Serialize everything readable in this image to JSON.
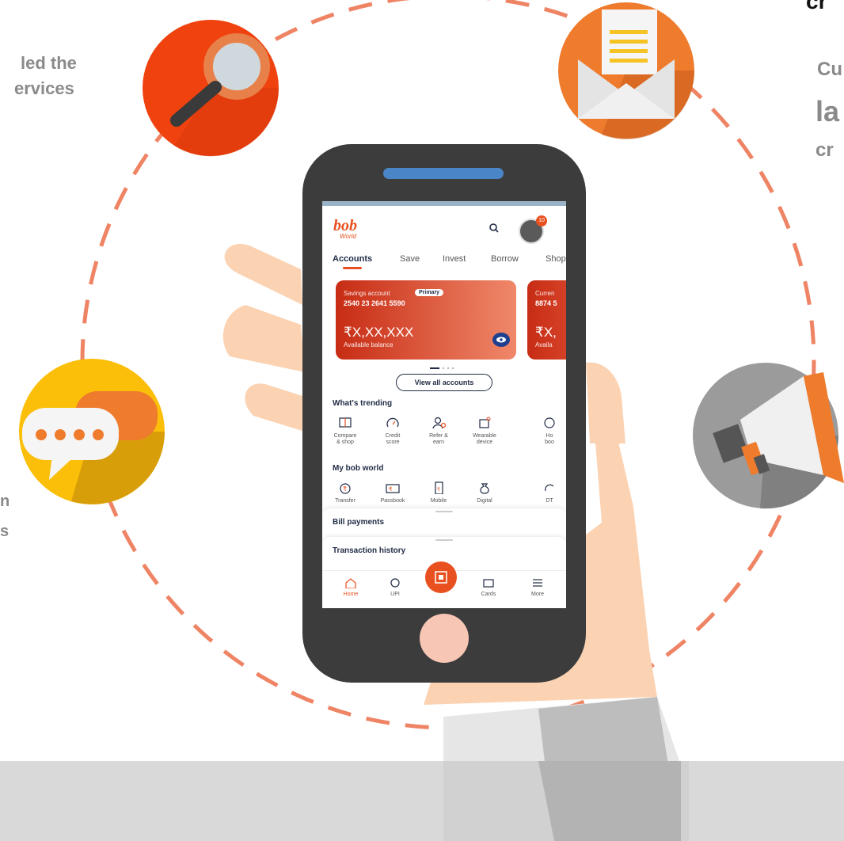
{
  "fragments": {
    "left_top_1": "led the",
    "left_top_2": "ervices",
    "left_mid_1": "n",
    "left_mid_2": "s",
    "right_top_1": "cr",
    "right_top_2": "Cu",
    "right_top_3": "la",
    "right_top_4": "cr"
  },
  "icons": [
    "search-icon",
    "envelope-icon",
    "chat-icon",
    "megaphone-icon"
  ],
  "colors": {
    "accent": "#e8501f",
    "dashed_circle": "#ef8465",
    "phone_body": "#3c3c3c",
    "hand": "#fbd3b3"
  },
  "app": {
    "logo": "bob",
    "logo_sub": "World",
    "notification_count": "10",
    "tabs": [
      "Accounts",
      "Save",
      "Invest",
      "Borrow",
      "Shop"
    ],
    "cards": [
      {
        "type": "Savings account",
        "badge": "Primary",
        "number": "2540 23 2641 5590",
        "balance": "₹X,XX,XXX",
        "balance_label": "Available balance"
      },
      {
        "type": "Curren",
        "number": "8874 5",
        "balance": "₹X,",
        "balance_label": "Availa"
      }
    ],
    "view_all": "View all accounts",
    "trending_title": "What's trending",
    "trending": [
      {
        "line1": "Compare",
        "line2": "& shop"
      },
      {
        "line1": "Credit",
        "line2": "score"
      },
      {
        "line1": "Refer &",
        "line2": "earn"
      },
      {
        "line1": "Wearable",
        "line2": "device"
      },
      {
        "line1": "Ho",
        "line2": "boo"
      }
    ],
    "myworld_title": "My bob world",
    "myworld": [
      {
        "line1": "Transfer"
      },
      {
        "line1": "Passbook"
      },
      {
        "line1": "Mobile"
      },
      {
        "line1": "Digital"
      },
      {
        "line1": "DT"
      }
    ],
    "bill_payments": "Bill payments",
    "transaction_history": "Transaction history",
    "nav": [
      "Home",
      "UPI",
      "Cards",
      "More"
    ]
  }
}
